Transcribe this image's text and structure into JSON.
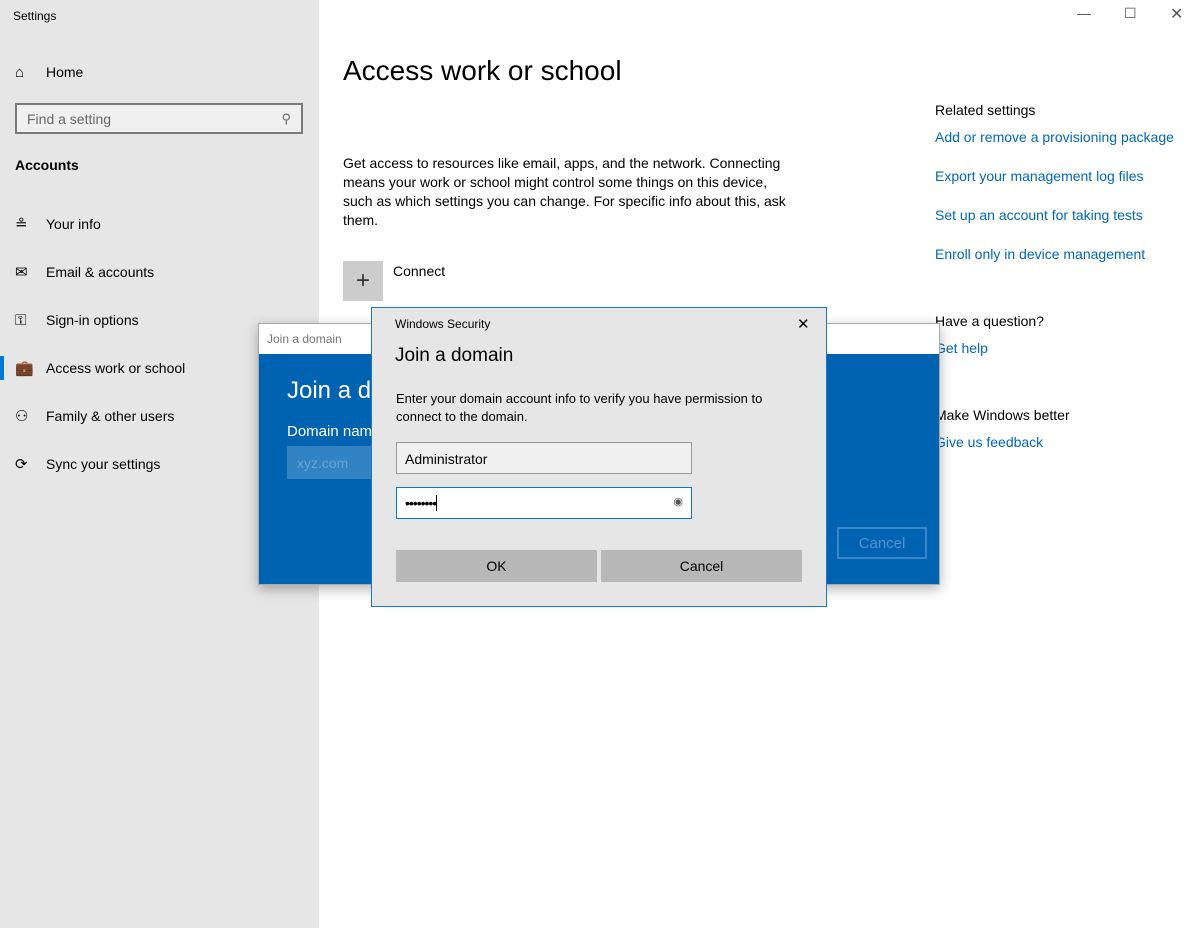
{
  "window": {
    "title": "Settings",
    "controls": [
      "minimize",
      "maximize",
      "close"
    ]
  },
  "sidebar": {
    "home": "Home",
    "search_placeholder": "Find a setting",
    "section": "Accounts",
    "items": [
      {
        "label": "Your info",
        "icon": "contact-info-icon"
      },
      {
        "label": "Email & accounts",
        "icon": "mail-icon"
      },
      {
        "label": "Sign-in options",
        "icon": "key-icon"
      },
      {
        "label": "Access work or school",
        "icon": "briefcase-icon",
        "selected": true
      },
      {
        "label": "Family & other users",
        "icon": "add-user-icon"
      },
      {
        "label": "Sync your settings",
        "icon": "sync-icon"
      }
    ]
  },
  "main": {
    "title": "Access work or school",
    "description": "Get access to resources like email, apps, and the network. Connecting means your work or school might control some things on this device, such as which settings you can change. For specific info about this, ask them.",
    "connect": "Connect"
  },
  "related": {
    "heading": "Related settings",
    "links": [
      "Add or remove a provisioning package",
      "Export your management log files",
      "Set up an account for taking tests",
      "Enroll only in device management"
    ],
    "question": "Have a question?",
    "help": "Get help",
    "better": "Make Windows better",
    "feedback": "Give us feedback"
  },
  "join_dialog": {
    "titlebar": "Join a domain",
    "heading": "Join a domain",
    "label": "Domain name",
    "placeholder": "xyz.com",
    "cancel": "Cancel"
  },
  "security": {
    "titlebar": "Windows Security",
    "heading": "Join a domain",
    "text": "Enter your domain account info to verify you have permission to connect to the domain.",
    "username": "Administrator",
    "password": "••••••••",
    "ok": "OK",
    "cancel": "Cancel"
  },
  "colors": {
    "accent": "#0067c0",
    "dialog_blue": "#0063b1"
  }
}
